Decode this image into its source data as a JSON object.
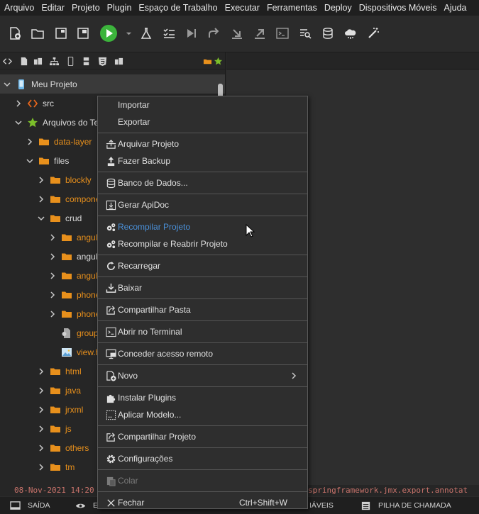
{
  "menubar": {
    "items": [
      "Arquivo",
      "Editar",
      "Projeto",
      "Plugin",
      "Espaço de Trabalho",
      "Executar",
      "Ferramentas",
      "Deploy",
      "Dispositivos Móveis",
      "Ajuda"
    ]
  },
  "toolbar": {
    "icons": [
      "new-project-icon",
      "open-folder-icon",
      "window-icon",
      "save-window-icon",
      "run-icon",
      "dropdown-arrow-icon",
      "flask-icon",
      "checklist-icon",
      "step-icon",
      "redo-icon",
      "download-icon",
      "upload-icon",
      "terminal-icon",
      "search-list-icon",
      "database-icon",
      "cloud-icon",
      "magic-wand-icon"
    ]
  },
  "sidebar": {
    "tree": [
      {
        "label": "Meu Projeto",
        "level": 0,
        "expanded": true,
        "icon": "mobile-icon",
        "color": "white",
        "selected": true
      },
      {
        "label": "src",
        "level": 1,
        "expanded": false,
        "icon": "code-folder-icon",
        "color": "white"
      },
      {
        "label": "Arquivos do Ter",
        "level": 1,
        "expanded": true,
        "icon": "star-icon",
        "color": "white"
      },
      {
        "label": "data-layer",
        "level": 2,
        "expanded": false,
        "icon": "folder-icon",
        "color": "orange"
      },
      {
        "label": "files",
        "level": 2,
        "expanded": true,
        "icon": "folder-icon",
        "color": "white"
      },
      {
        "label": "blockly",
        "level": 3,
        "expanded": false,
        "icon": "folder-icon",
        "color": "orange"
      },
      {
        "label": "componen",
        "level": 3,
        "expanded": false,
        "icon": "folder-icon",
        "color": "orange"
      },
      {
        "label": "crud",
        "level": 3,
        "expanded": true,
        "icon": "folder-icon",
        "color": "white"
      },
      {
        "label": "angula",
        "level": 4,
        "expanded": false,
        "icon": "folder-icon",
        "color": "orange"
      },
      {
        "label": "angula",
        "level": 4,
        "expanded": false,
        "icon": "folder-icon",
        "color": "white"
      },
      {
        "label": "angula",
        "level": 4,
        "expanded": false,
        "icon": "folder-icon",
        "color": "orange"
      },
      {
        "label": "phone",
        "level": 4,
        "expanded": false,
        "icon": "folder-icon",
        "color": "orange"
      },
      {
        "label": "phone",
        "level": 4,
        "expanded": false,
        "icon": "folder-icon",
        "color": "orange"
      },
      {
        "label": "group.",
        "level": 4,
        "leaf": true,
        "icon": "file-gear-icon",
        "color": "orange"
      },
      {
        "label": "view.ht",
        "level": 4,
        "leaf": true,
        "icon": "image-file-icon",
        "color": "orange"
      },
      {
        "label": "html",
        "level": 3,
        "expanded": false,
        "icon": "folder-icon",
        "color": "orange"
      },
      {
        "label": "java",
        "level": 3,
        "expanded": false,
        "icon": "folder-icon",
        "color": "orange"
      },
      {
        "label": "jrxml",
        "level": 3,
        "expanded": false,
        "icon": "folder-icon",
        "color": "orange"
      },
      {
        "label": "js",
        "level": 3,
        "expanded": false,
        "icon": "folder-icon",
        "color": "orange"
      },
      {
        "label": "others",
        "level": 3,
        "expanded": false,
        "icon": "folder-icon",
        "color": "orange"
      },
      {
        "label": "tm",
        "level": 3,
        "expanded": false,
        "icon": "folder-icon",
        "color": "orange"
      }
    ]
  },
  "context_menu": {
    "items": [
      {
        "label": "Importar",
        "icon": ""
      },
      {
        "label": "Exportar",
        "icon": ""
      },
      {
        "sep": true
      },
      {
        "label": "Arquivar Projeto",
        "icon": "archive-icon"
      },
      {
        "label": "Fazer Backup",
        "icon": "backup-icon"
      },
      {
        "sep": true
      },
      {
        "label": "Banco de Dados...",
        "icon": "database-icon"
      },
      {
        "sep": true
      },
      {
        "label": "Gerar ApiDoc",
        "icon": "apidoc-icon"
      },
      {
        "sep": true
      },
      {
        "label": "Recompilar Projeto",
        "icon": "gears-icon",
        "highlighted": true
      },
      {
        "label": "Recompilar e Reabrir Projeto",
        "icon": "gears-icon"
      },
      {
        "sep": true
      },
      {
        "label": "Recarregar",
        "icon": "reload-icon"
      },
      {
        "sep": true
      },
      {
        "label": "Baixar",
        "icon": "download-icon"
      },
      {
        "sep": true
      },
      {
        "label": "Compartilhar Pasta",
        "icon": "share-icon"
      },
      {
        "sep": true
      },
      {
        "label": "Abrir no Terminal",
        "icon": "terminal-icon"
      },
      {
        "sep": true
      },
      {
        "label": "Conceder acesso remoto",
        "icon": "remote-icon"
      },
      {
        "sep": true
      },
      {
        "label": "Novo",
        "icon": "new-icon",
        "submenu": true
      },
      {
        "sep": true
      },
      {
        "label": "Instalar Plugins",
        "icon": "plugin-icon"
      },
      {
        "label": "Aplicar Modelo...",
        "icon": "template-icon"
      },
      {
        "sep": true
      },
      {
        "label": "Compartilhar Projeto",
        "icon": "share-icon"
      },
      {
        "sep": true
      },
      {
        "label": "Configurações",
        "icon": "gear-icon"
      },
      {
        "sep": true
      },
      {
        "label": "Colar",
        "icon": "paste-icon",
        "disabled": true
      },
      {
        "sep": true
      },
      {
        "label": "Fechar",
        "icon": "close-icon",
        "shortcut": "Ctrl+Shift+W"
      }
    ]
  },
  "console": {
    "left_text": "08-Nov-2021 14:20",
    "right_text": "springframework.jmx.export.annotat"
  },
  "bottombar": {
    "tabs": [
      {
        "label": "SAÍDA",
        "icon": "output-icon"
      },
      {
        "label": "E",
        "icon": "eye-icon"
      },
      {
        "label": "IÁVEIS",
        "icon": ""
      },
      {
        "label": "PILHA DE CHAMADA",
        "icon": "stack-icon"
      }
    ]
  },
  "colors": {
    "accent_blue": "#4a90d9",
    "folder_orange": "#e8901c",
    "run_green": "#3cb43c"
  }
}
